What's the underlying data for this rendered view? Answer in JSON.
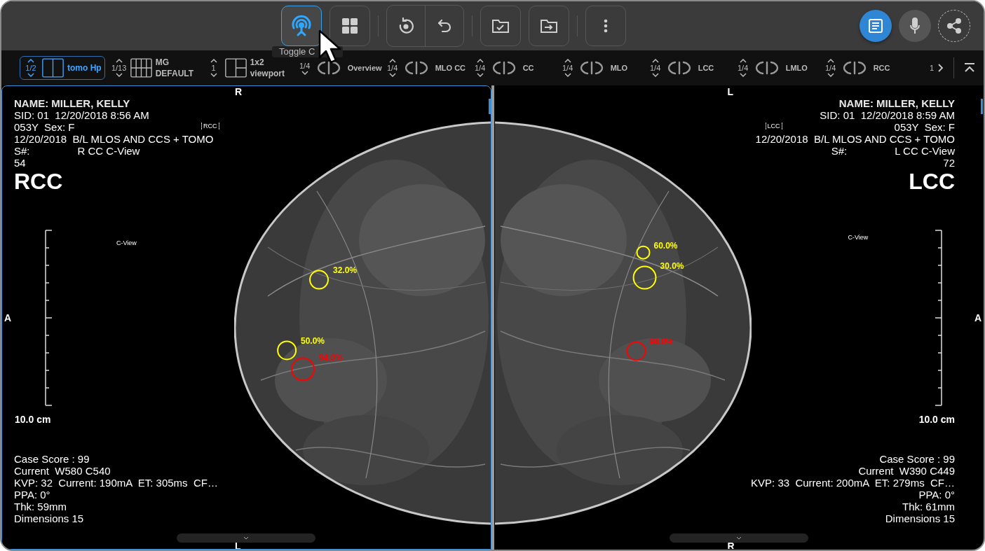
{
  "toolbar": {
    "groups": [
      {
        "joined": false,
        "buttons": [
          {
            "kind": "toggle",
            "selected": true
          },
          {
            "kind": "grid",
            "selected": false
          }
        ]
      },
      {
        "joined": true,
        "buttons": [
          {
            "kind": "rotate",
            "selected": false
          },
          {
            "kind": "undo",
            "selected": false
          }
        ]
      },
      {
        "joined": false,
        "buttons": [
          {
            "kind": "folder-check",
            "selected": false
          },
          {
            "kind": "folder-move",
            "selected": false
          }
        ]
      },
      {
        "joined": false,
        "buttons": [
          {
            "kind": "more",
            "selected": false
          }
        ]
      }
    ],
    "tooltip": "Toggle C",
    "actions": [
      {
        "kind": "report",
        "selected": true
      },
      {
        "kind": "mic",
        "selected": false
      },
      {
        "kind": "share",
        "selected": false
      }
    ]
  },
  "protocols": [
    {
      "counter": "1/2",
      "label": "tomo Hp",
      "kind": "split",
      "selected": true
    },
    {
      "counter": "1/13",
      "label": "MG DEFAULT",
      "kind": "grid",
      "selected": false
    },
    {
      "counter": "1",
      "label": "1x2 viewport",
      "kind": "one-two",
      "selected": false
    }
  ],
  "views": [
    {
      "counter": "1/4",
      "label": "Overview"
    },
    {
      "counter": "1/4",
      "label": "MLO CC"
    },
    {
      "counter": "1/4",
      "label": "CC"
    },
    {
      "counter": "1/4",
      "label": "MLO"
    },
    {
      "counter": "1/4",
      "label": "LCC"
    },
    {
      "counter": "1/4",
      "label": "LMLO"
    },
    {
      "counter": "1/4",
      "label": "RCC"
    }
  ],
  "views_more": "1",
  "viewports": [
    {
      "selected": true,
      "top_marker": "R",
      "side_marker": "A",
      "bottom_marker": "L",
      "info": [
        "NAME: MILLER, KELLY",
        "SID: 01  12/20/2018 8:56 AM",
        "053Y  Sex: F",
        "12/20/2018  B/L MLOS AND CCS + TOMO"
      ],
      "series_prefix": "S#:",
      "series_view": "R CC C-View",
      "number": "54",
      "view_label": "RCC",
      "tag": "RCC",
      "cview": "C-View",
      "scale": "10.0 cm",
      "footer": [
        "Case Score : 99",
        "Current  W580 C540",
        "KVP: 32  Current: 190mA  ET: 305ms  CF…",
        "PPA: 0°",
        "Thk: 59mm",
        "Dimensions 15"
      ],
      "findings": [
        {
          "score": "32.0%",
          "color": "#ffff00"
        },
        {
          "score": "50.0%",
          "color": "#ffff00"
        },
        {
          "score": "94.0%",
          "color": "#ff0000"
        }
      ]
    },
    {
      "selected": false,
      "top_marker": "L",
      "side_marker": "A",
      "bottom_marker": "R",
      "info": [
        "NAME: MILLER, KELLY",
        "SID: 01  12/20/2018 8:59 AM",
        "053Y  Sex: F",
        "12/20/2018  B/L MLOS AND CCS + TOMO"
      ],
      "series_prefix": "S#:",
      "series_view": "L CC C-View",
      "number": "72",
      "view_label": "LCC",
      "tag": "LCC",
      "cview": "C-View",
      "scale": "10.0 cm",
      "footer": [
        "Case Score : 99",
        "Current  W390 C449",
        "KVP: 33  Current: 200mA  ET: 279ms  CF…",
        "PPA: 0°",
        "Thk: 61mm",
        "Dimensions 15"
      ],
      "findings": [
        {
          "score": "60.0%",
          "color": "#ffff00"
        },
        {
          "score": "30.0%",
          "color": "#ffff00"
        },
        {
          "score": "98.0%",
          "color": "#ff0000"
        }
      ]
    }
  ]
}
